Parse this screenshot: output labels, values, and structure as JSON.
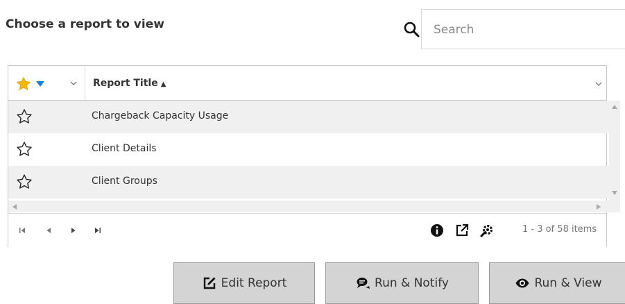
{
  "page": {
    "title": "Choose a report to view"
  },
  "search": {
    "placeholder": "Search"
  },
  "grid": {
    "header": {
      "column_title": "Report Title",
      "sort_indicator": "▲"
    },
    "rows": [
      {
        "label": "Chargeback Capacity Usage",
        "favorite": false
      },
      {
        "label": "Client Details",
        "favorite": false
      },
      {
        "label": "Client Groups",
        "favorite": false
      }
    ],
    "pager": {
      "summary": "1 - 3 of 58 items"
    }
  },
  "buttons": {
    "edit": "Edit Report",
    "notify": "Run & Notify",
    "view": "Run & View"
  },
  "colors": {
    "favorite_star": "#f2b700",
    "sort_triangle": "#1a7fd0",
    "row_alt": "#f0f0f0",
    "button_bg": "#d4d4d4"
  },
  "icons": [
    "search-icon",
    "star-icon",
    "sort-icon",
    "chevron-down-icon",
    "info-icon",
    "open-external-icon",
    "settings-icon",
    "edit-icon",
    "notify-icon",
    "eye-icon"
  ]
}
